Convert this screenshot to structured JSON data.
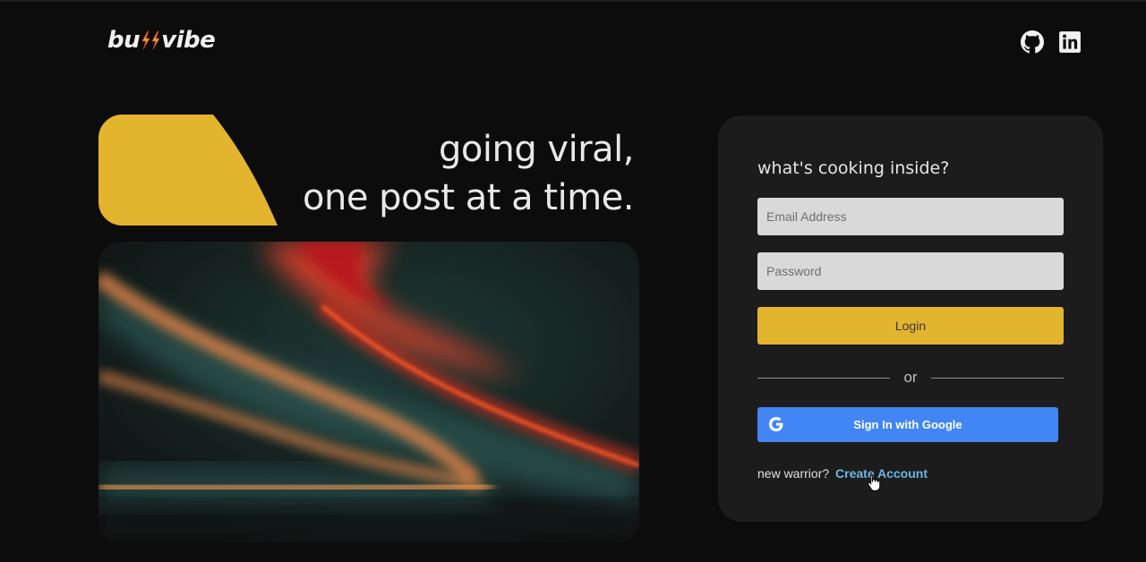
{
  "header": {
    "logo_left": "bu",
    "logo_right": "vibe",
    "icons": [
      "github-icon",
      "linkedin-icon"
    ]
  },
  "hero": {
    "tagline_line1": "going viral,",
    "tagline_line2": "one post at a time."
  },
  "login": {
    "title": "what's cooking inside?",
    "email_placeholder": "Email Address",
    "password_placeholder": "Password",
    "login_label": "Login",
    "divider_text": "or",
    "google_label": "Sign In with Google",
    "signup_prompt": "new warrior?",
    "signup_link": "Create Account"
  },
  "colors": {
    "background": "#0c0c0c",
    "card": "#1c1c1c",
    "accent_yellow": "#e3b42d",
    "google_blue": "#4285f4",
    "link": "#6fb6e6"
  }
}
